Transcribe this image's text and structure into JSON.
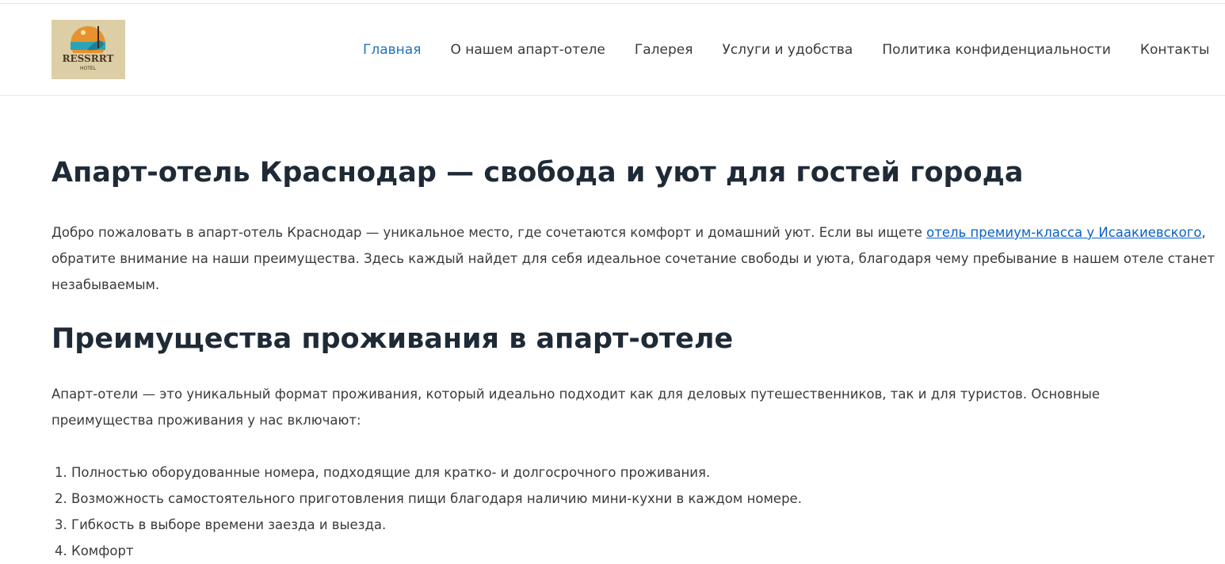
{
  "header": {
    "logo_text": "RESSRRT HOTEL",
    "nav": [
      {
        "label": "Главная",
        "active": true
      },
      {
        "label": "О нашем апарт-отеле"
      },
      {
        "label": "Галерея"
      },
      {
        "label": "Услуги и удобства"
      },
      {
        "label": "Политика конфиденциальности"
      },
      {
        "label": "Контакты"
      }
    ]
  },
  "main": {
    "title": "Апарт-отель Краснодар — свобода и уют для гостей города",
    "intro_before": "Добро пожаловать в апарт-отель Краснодар — уникальное место, где сочетаются комфорт и домашний уют. Если вы ищете ",
    "intro_link": "отель премиум-класса у Исаакиевского",
    "intro_after": ", обратите внимание на наши преимущества. Здесь каждый найдет для себя идеальное сочетание свободы и уюта, благодаря чему пребывание в нашем отеле станет незабываемым.",
    "subtitle": "Преимущества проживания в апарт-отеле",
    "paragraph": "Апарт-отели — это уникальный формат проживания, который идеально подходит как для деловых путешественников, так и для туристов. Основные преимущества проживания у нас включают:",
    "list": [
      "Полностью оборудованные номера, подходящие для кратко- и долгосрочного проживания.",
      "Возможность самостоятельного приготовления пищи благодаря наличию мини-кухни в каждом номере.",
      "Гибкость в выборе времени заезда и выезда.",
      "Комфорт"
    ]
  }
}
